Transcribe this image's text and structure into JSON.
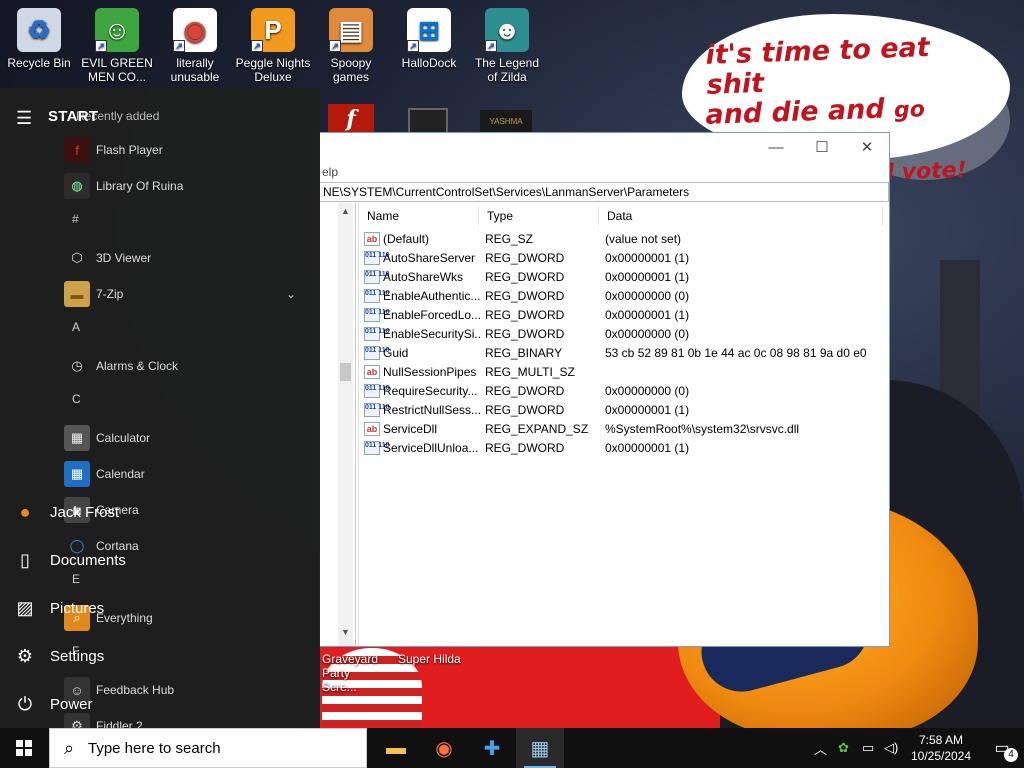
{
  "desktop": {
    "icons": [
      {
        "label": "Recycle Bin",
        "icon": "recycle-bin-icon"
      },
      {
        "label": "EVIL GREEN MEN CO...",
        "icon": "green-men-icon"
      },
      {
        "label": "literally unusable",
        "icon": "chrome-icon"
      },
      {
        "label": "Peggle Nights Deluxe",
        "icon": "peggle-icon"
      },
      {
        "label": "Spoopy games",
        "icon": "folder-icon"
      },
      {
        "label": "HalloDock",
        "icon": "windows-logo-icon"
      },
      {
        "label": "The Legend of Zilda",
        "icon": "zilda-icon"
      }
    ],
    "hidden_icons": [
      {
        "label": "Graveyard Party Scre...",
        "icon": "graveyard-icon"
      },
      {
        "label": "Super Hilda",
        "icon": "hilda-icon"
      }
    ],
    "speech_bubble": {
      "line1": "it's time to eat shit",
      "line2a": "and die and ",
      "line2b": "go trick",
      "line3": "or treating and vote!"
    }
  },
  "regedit": {
    "menu_fragment": "elp",
    "address": "NE\\SYSTEM\\CurrentControlSet\\Services\\LanmanServer\\Parameters",
    "columns": {
      "name": "Name",
      "type": "Type",
      "data": "Data"
    },
    "rows": [
      {
        "name": "(Default)",
        "type": "REG_SZ",
        "data": "(value not set)",
        "kind": "ab"
      },
      {
        "name": "AutoShareServer",
        "type": "REG_DWORD",
        "data": "0x00000001 (1)",
        "kind": "bin"
      },
      {
        "name": "AutoShareWks",
        "type": "REG_DWORD",
        "data": "0x00000001 (1)",
        "kind": "bin"
      },
      {
        "name": "EnableAuthentic...",
        "type": "REG_DWORD",
        "data": "0x00000000 (0)",
        "kind": "bin"
      },
      {
        "name": "EnableForcedLo...",
        "type": "REG_DWORD",
        "data": "0x00000001 (1)",
        "kind": "bin"
      },
      {
        "name": "EnableSecuritySi...",
        "type": "REG_DWORD",
        "data": "0x00000000 (0)",
        "kind": "bin"
      },
      {
        "name": "Guid",
        "type": "REG_BINARY",
        "data": "53 cb 52 89 81 0b 1e 44 ac 0c 08 98 81 9a d0 e0",
        "kind": "bin"
      },
      {
        "name": "NullSessionPipes",
        "type": "REG_MULTI_SZ",
        "data": "",
        "kind": "ab"
      },
      {
        "name": "RequireSecurity...",
        "type": "REG_DWORD",
        "data": "0x00000000 (0)",
        "kind": "bin"
      },
      {
        "name": "RestrictNullSess...",
        "type": "REG_DWORD",
        "data": "0x00000001 (1)",
        "kind": "bin"
      },
      {
        "name": "ServiceDll",
        "type": "REG_EXPAND_SZ",
        "data": "%SystemRoot%\\system32\\srvsvc.dll",
        "kind": "ab"
      },
      {
        "name": "ServiceDllUnloa...",
        "type": "REG_DWORD",
        "data": "0x00000001 (1)",
        "kind": "bin"
      }
    ],
    "controls": {
      "minimize": "—",
      "maximize": "☐",
      "close": "✕"
    }
  },
  "start_menu": {
    "title": "START",
    "recent_label": "Recently added",
    "rail": [
      {
        "label": "Jack Frost",
        "icon": "user-avatar-icon"
      },
      {
        "label": "Documents",
        "icon": "document-icon"
      },
      {
        "label": "Pictures",
        "icon": "pictures-icon"
      },
      {
        "label": "Settings",
        "icon": "gear-icon"
      },
      {
        "label": "Power",
        "icon": "power-icon"
      }
    ],
    "apps": [
      {
        "type": "app",
        "label": "Flash Player",
        "icon": "flash-icon"
      },
      {
        "type": "app",
        "label": "Library Of Ruina",
        "icon": "ruina-icon"
      },
      {
        "type": "letter",
        "label": "#"
      },
      {
        "type": "app",
        "label": "3D Viewer",
        "icon": "cube-icon"
      },
      {
        "type": "app",
        "label": "7-Zip",
        "icon": "folder-icon",
        "expandable": true
      },
      {
        "type": "letter",
        "label": "A"
      },
      {
        "type": "app",
        "label": "Alarms & Clock",
        "icon": "clock-icon"
      },
      {
        "type": "letter",
        "label": "C"
      },
      {
        "type": "app",
        "label": "Calculator",
        "icon": "calculator-icon"
      },
      {
        "type": "app",
        "label": "Calendar",
        "icon": "calendar-icon"
      },
      {
        "type": "app",
        "label": "Camera",
        "icon": "camera-icon"
      },
      {
        "type": "app",
        "label": "Cortana",
        "icon": "cortana-icon"
      },
      {
        "type": "letter",
        "label": "E"
      },
      {
        "type": "app",
        "label": "Everything",
        "icon": "search-icon"
      },
      {
        "type": "letter",
        "label": "F"
      },
      {
        "type": "app",
        "label": "Feedback Hub",
        "icon": "feedback-icon"
      },
      {
        "type": "app",
        "label": "Fiddler 2",
        "icon": "fiddler-icon"
      }
    ]
  },
  "taskbar": {
    "search_placeholder": "Type here to search",
    "apps": [
      {
        "name": "file-explorer",
        "icon": "folder-icon"
      },
      {
        "name": "firefox",
        "icon": "firefox-icon"
      },
      {
        "name": "network-app",
        "icon": "network-icon"
      },
      {
        "name": "regedit",
        "icon": "regedit-icon",
        "active": true
      }
    ],
    "time": "7:58 AM",
    "date": "10/25/2024",
    "notification_count": "4"
  }
}
